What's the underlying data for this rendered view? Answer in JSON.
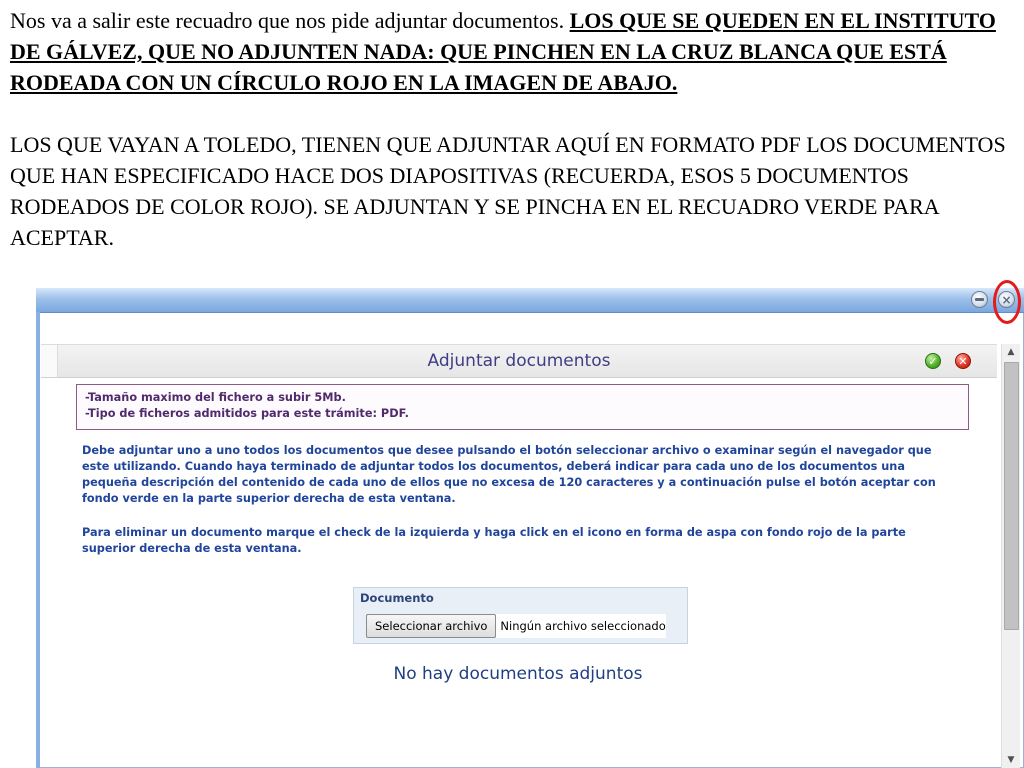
{
  "slide": {
    "intro": "Nos va a salir este recuadro que nos pide adjuntar documentos. ",
    "emphasis": "LOS QUE SE QUEDEN EN EL INSTITUTO DE GÁLVEZ, QUE NO ADJUNTEN NADA: QUE PINCHEN EN LA CRUZ BLANCA QUE ESTÁ RODEADA CON UN CÍRCULO ROJO EN LA IMAGEN DE ABAJO.",
    "paragraph2": "LOS QUE VAYAN A TOLEDO, TIENEN QUE ADJUNTAR AQUÍ EN FORMATO PDF LOS DOCUMENTOS QUE HAN ESPECIFICADO HACE DOS DIAPOSITIVAS (RECUERDA, ESOS 5 DOCUMENTOS RODEADOS DE COLOR ROJO). SE ADJUNTAN Y SE PINCHA EN EL RECUADRO VERDE PARA ACEPTAR."
  },
  "window": {
    "minimize_icon": "minimize-icon",
    "close_icon": "close-icon",
    "highlight_color": "#e41b1b"
  },
  "dialog": {
    "title": "Adjuntar documentos",
    "accept_icon": "check-icon",
    "delete_icon": "x-icon",
    "info_lines": [
      "-Tamaño maximo del fichero a subir 5Mb.",
      "-Tipo de ficheros admitidos para este trámite: PDF."
    ],
    "description1": "Debe adjuntar uno a uno todos los documentos que desee pulsando el botón seleccionar archivo o examinar según el navegador que este utilizando. Cuando haya terminado de adjuntar todos los documentos, deberá indicar para cada uno de los documentos una pequeña descripción del contenido de cada uno de ellos que no excesa de 120 caracteres y a continuación pulse el botón aceptar con fondo verde en la parte superior derecha de esta ventana.",
    "description2": "Para eliminar un documento marque el check de la izquierda y haga click en el icono en forma de aspa con fondo rojo de la parte superior derecha de esta ventana.",
    "document_panel": {
      "header": "Documento",
      "file_button": "Seleccionar archivo",
      "file_status": "Ningún archivo seleccionado"
    },
    "empty_message": "No hay documentos adjuntos"
  },
  "colors": {
    "accept": "#54b52b",
    "delete": "#e3382b",
    "title": "#3e3d85",
    "description": "#21459a"
  }
}
